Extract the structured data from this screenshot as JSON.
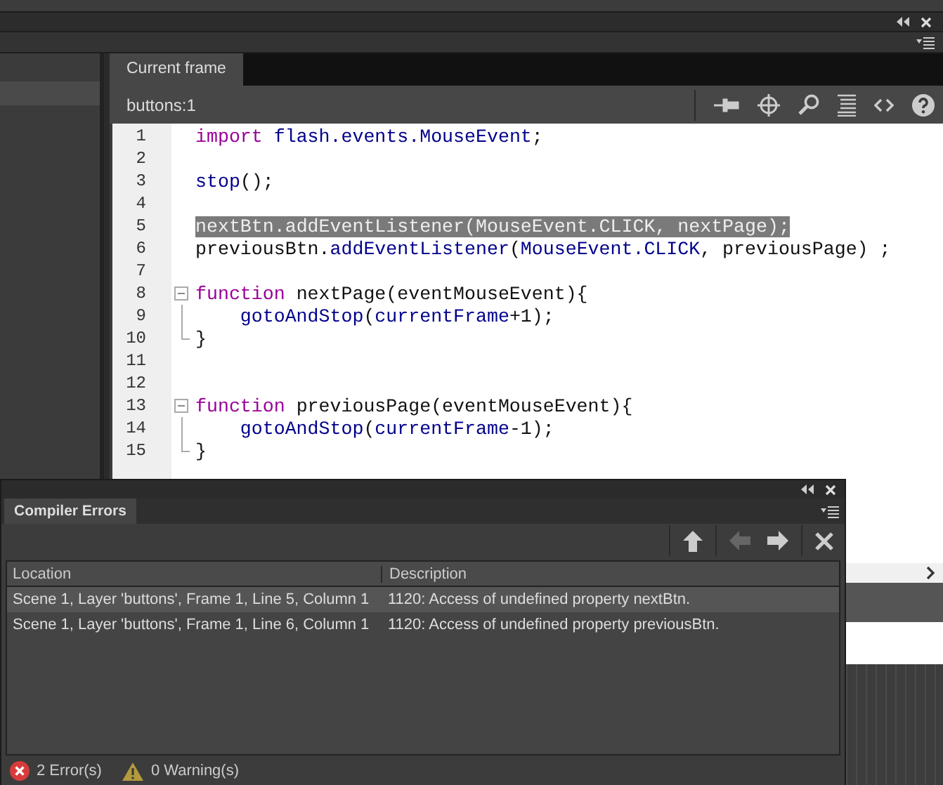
{
  "editor": {
    "tab": {
      "label": "Current frame",
      "selected": true
    },
    "location": "buttons:1",
    "lines": [
      {
        "number": "1",
        "selected": false,
        "kind": "plain",
        "tokens": [
          {
            "kind": "keyword",
            "text": "import"
          },
          {
            "kind": "builtin",
            "text": " flash.events.MouseEvent"
          },
          {
            "kind": "plain",
            "text": ";"
          }
        ]
      },
      {
        "number": "2",
        "selected": false,
        "kind": "plain"
      },
      {
        "number": "3",
        "selected": false,
        "kind": "plain",
        "tokens": [
          {
            "kind": "builtin",
            "text": "stop"
          },
          {
            "kind": "plain",
            "text": "();"
          }
        ]
      },
      {
        "number": "4",
        "selected": false,
        "kind": "plain"
      },
      {
        "number": "5",
        "selected": true,
        "kind": "plain",
        "tokens": [
          {
            "kind": "plain",
            "text": "nextBtn."
          },
          {
            "kind": "builtin",
            "text": "addEventListener"
          },
          {
            "kind": "plain",
            "text": "("
          },
          {
            "kind": "builtin",
            "text": "MouseEvent.CLICK"
          },
          {
            "kind": "plain",
            "text": ", nextPage);"
          }
        ]
      },
      {
        "number": "6",
        "selected": false,
        "kind": "plain",
        "tokens": [
          {
            "kind": "plain",
            "text": "previousBtn."
          },
          {
            "kind": "builtin",
            "text": "addEventListener"
          },
          {
            "kind": "plain",
            "text": "("
          },
          {
            "kind": "builtin",
            "text": "MouseEvent.CLICK"
          },
          {
            "kind": "plain",
            "text": ", previousPage) ;"
          }
        ]
      },
      {
        "number": "7",
        "selected": false,
        "kind": "plain"
      },
      {
        "number": "8",
        "selected": false,
        "kind": "fold-start",
        "tokens": [
          {
            "kind": "keyword",
            "text": "function"
          },
          {
            "kind": "plain",
            "text": " nextPage(eventMouseEvent){"
          }
        ]
      },
      {
        "number": "9",
        "selected": false,
        "kind": "fold-body",
        "tokens": [
          {
            "kind": "builtin",
            "text": "gotoAndStop"
          },
          {
            "kind": "plain",
            "text": "("
          },
          {
            "kind": "builtin",
            "text": "currentFrame"
          },
          {
            "kind": "plain",
            "text": "+1);"
          }
        ]
      },
      {
        "number": "10",
        "selected": false,
        "kind": "fold-end",
        "tokens": [
          {
            "kind": "plain",
            "text": "}"
          }
        ]
      },
      {
        "number": "11",
        "selected": false,
        "kind": "plain"
      },
      {
        "number": "12",
        "selected": false,
        "kind": "plain"
      },
      {
        "number": "13",
        "selected": false,
        "kind": "fold-start",
        "tokens": [
          {
            "kind": "keyword",
            "text": "function"
          },
          {
            "kind": "plain",
            "text": " previousPage(eventMouseEvent){"
          }
        ]
      },
      {
        "number": "14",
        "selected": false,
        "kind": "fold-body",
        "tokens": [
          {
            "kind": "builtin",
            "text": "gotoAndStop"
          },
          {
            "kind": "plain",
            "text": "("
          },
          {
            "kind": "builtin",
            "text": "currentFrame"
          },
          {
            "kind": "plain",
            "text": "-1);"
          }
        ]
      },
      {
        "number": "15",
        "selected": false,
        "kind": "fold-end",
        "tokens": [
          {
            "kind": "plain",
            "text": "}"
          }
        ]
      }
    ]
  },
  "compiler_errors": {
    "tab": {
      "label": "Compiler Errors",
      "selected": true
    },
    "toolbar": [
      {
        "kind": "up",
        "disabled": false
      },
      {
        "kind": "left",
        "disabled": true
      },
      {
        "kind": "right",
        "disabled": false
      },
      {
        "kind": "close",
        "disabled": false
      }
    ],
    "columns": [
      "Location",
      "Description"
    ],
    "rows": [
      {
        "location": "Scene 1, Layer 'buttons', Frame 1, Line 5, Column 1",
        "description": "1120: Access of undefined property nextBtn.",
        "selected": true
      },
      {
        "location": "Scene 1, Layer 'buttons', Frame 1, Line 6, Column 1",
        "description": "1120: Access of undefined property previousBtn.",
        "selected": false
      }
    ],
    "status": {
      "errors": "2 Error(s)",
      "warnings": "0 Warning(s)"
    }
  }
}
